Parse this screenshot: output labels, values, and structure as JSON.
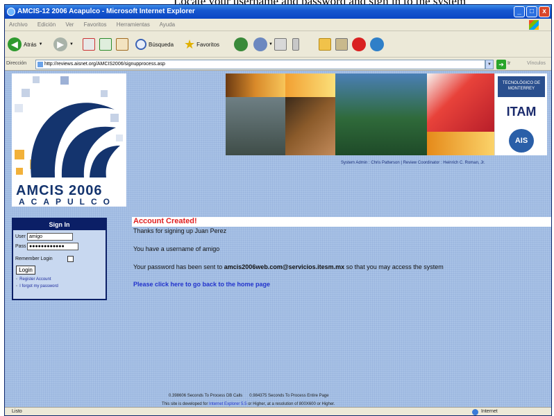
{
  "document": {
    "cut_text": "Locate your username and password and sign in to the system"
  },
  "window": {
    "title": "AMCIS-12 2006 Acapulco - Microsoft Internet Explorer",
    "buttons": [
      "_",
      "□",
      "x"
    ]
  },
  "menu": {
    "items": [
      "Archivo",
      "Edición",
      "Ver",
      "Favoritos",
      "Herramientas",
      "Ayuda"
    ]
  },
  "toolbar": {
    "back_label": "Atrás",
    "search_label": "Búsqueda",
    "favorites_label": "Favoritos"
  },
  "address": {
    "label": "Dirección",
    "url": "http://reviews.aisnet.org/AMCIS2006/signupprocess.asp",
    "go_label": "Ir",
    "links_label": "Vínculos"
  },
  "logo": {
    "line1": "AMCIS 2006",
    "line2": "ACAPULCO"
  },
  "banner": {
    "tec_label": "TECNOLÓGICO DE MONTERREY",
    "itam_label": "ITAM",
    "ais_label": "AIS"
  },
  "credits": {
    "text": "System Admin : Chris Patterson | Review Coordinator : Heinrich C. Roman, Jr."
  },
  "signin": {
    "title": "Sign In",
    "user_label": "User",
    "user_value": "amigo",
    "pass_label": "Pass",
    "pass_value": "●●●●●●●●●●●●",
    "remember_label": "Remember Login",
    "login_label": "Login",
    "register_link": "Register Account",
    "forgot_link": "I forgot my password"
  },
  "message": {
    "title": "Account Created!",
    "thanks": "Thanks for signing up Juan Perez",
    "username_line": "You have a username of amigo",
    "password_prefix": "Your password has been sent to",
    "email": "amcis2006web.com@servicios.itesm.mx",
    "password_suffix": "so that you may access the system",
    "home_link": "Please click here to go back to the home page"
  },
  "footer": {
    "timing": "0.398606 Seconds To Process DB Calls      0.984375 Seconds To Process Entire Page",
    "note_prefix": "This site is developed for",
    "note_link": "Internet Explorer 5.5",
    "note_suffix": "or Higher, at a resolution of 800X600 or Higher."
  },
  "status": {
    "done": "Listo",
    "zone": "Internet"
  },
  "colors": {
    "content_bg": "#a8c2e6",
    "signin_header": "#0b1f66",
    "alert_red": "#e02020",
    "link_blue": "#2233cc",
    "logo_navy": "#14346e"
  }
}
